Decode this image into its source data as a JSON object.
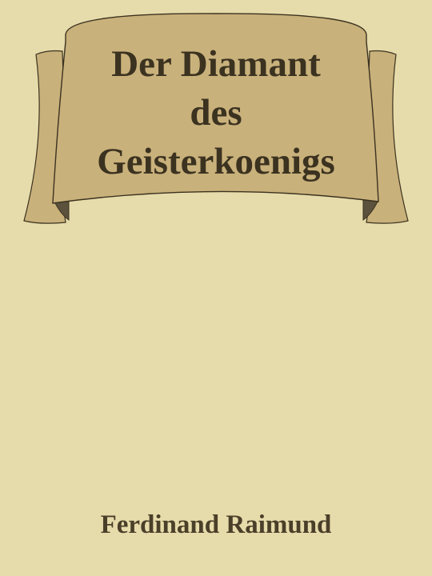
{
  "cover": {
    "title_lines": [
      "Der Diamant",
      "des",
      "Geisterkoenigs"
    ],
    "author": "Ferdinand Raimund",
    "colors": {
      "background": "#e6dbaa",
      "banner": "#c9b17b",
      "banner_shadow": "#5b513c",
      "outline": "#3b3220",
      "text": "#3b3220"
    }
  }
}
